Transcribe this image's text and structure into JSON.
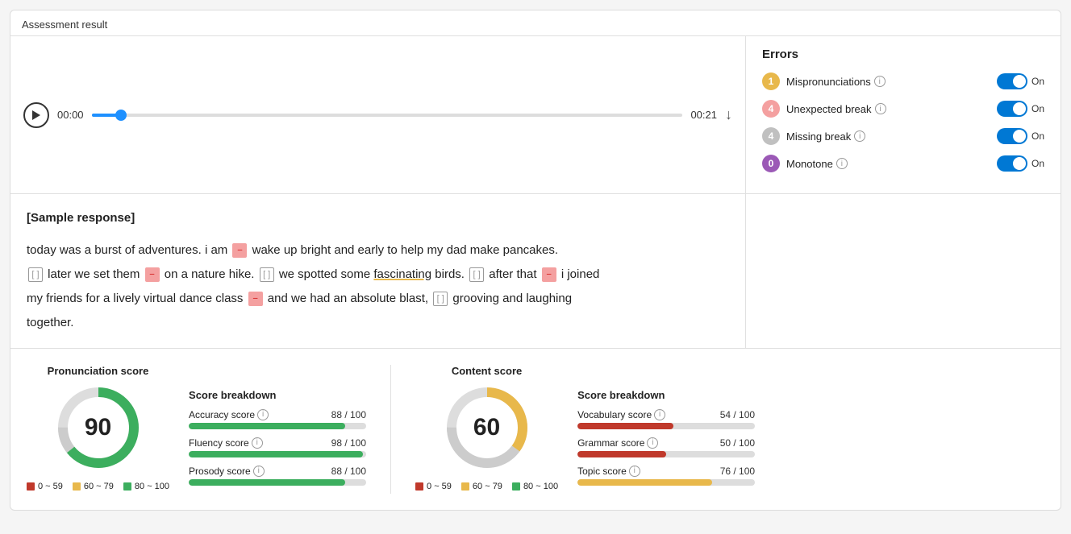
{
  "page": {
    "title": "Assessment result"
  },
  "audio": {
    "time_start": "00:00",
    "time_end": "00:21",
    "progress_pct": 5
  },
  "errors": {
    "title": "Errors",
    "items": [
      {
        "id": "mispronunciations",
        "count": "1",
        "label": "Mispronunciations",
        "badge_class": "badge-yellow",
        "toggle": "On"
      },
      {
        "id": "unexpected-break",
        "count": "4",
        "label": "Unexpected break",
        "badge_class": "badge-pink",
        "toggle": "On"
      },
      {
        "id": "missing-break",
        "count": "4",
        "label": "Missing break",
        "badge_class": "badge-gray",
        "toggle": "On"
      },
      {
        "id": "monotone",
        "count": "0",
        "label": "Monotone",
        "badge_class": "badge-purple",
        "toggle": "On"
      }
    ]
  },
  "text_response": {
    "sample_label": "[Sample response]",
    "sentences": [
      "today was a burst of adventures. i am [×] wake up bright and early to help my dad make pancakes.",
      "[ ] later we set them [×] on a nature hike. [ ] we spotted some fascinating birds. [ ] after that [×] i joined",
      "my friends for a lively virtual dance class [×] and we had an absolute blast, [ ] grooving and laughing",
      "together."
    ]
  },
  "pronunciation_score": {
    "title": "Pronunciation score",
    "value": 90,
    "donut_green_pct": 90,
    "legend": [
      {
        "color": "#c0392b",
        "label": "0 ~ 59"
      },
      {
        "color": "#e8b84b",
        "label": "60 ~ 79"
      },
      {
        "color": "#3cae5e",
        "label": "80 ~ 100"
      }
    ]
  },
  "pronunciation_breakdown": {
    "title": "Score breakdown",
    "items": [
      {
        "label": "Accuracy score",
        "value": "88 / 100",
        "pct": 88,
        "color": "green"
      },
      {
        "label": "Fluency score",
        "value": "98 / 100",
        "pct": 98,
        "color": "green"
      },
      {
        "label": "Prosody score",
        "value": "88 / 100",
        "pct": 88,
        "color": "green"
      }
    ]
  },
  "content_score": {
    "title": "Content score",
    "value": 60,
    "donut_yellow_pct": 60,
    "legend": [
      {
        "color": "#c0392b",
        "label": "0 ~ 59"
      },
      {
        "color": "#e8b84b",
        "label": "60 ~ 79"
      },
      {
        "color": "#3cae5e",
        "label": "80 ~ 100"
      }
    ]
  },
  "content_breakdown": {
    "title": "Score breakdown",
    "items": [
      {
        "label": "Vocabulary score",
        "value": "54 / 100",
        "pct": 54,
        "color": "red"
      },
      {
        "label": "Grammar score",
        "value": "50 / 100",
        "pct": 50,
        "color": "red"
      },
      {
        "label": "Topic score",
        "value": "76 / 100",
        "pct": 76,
        "color": "yellow"
      }
    ]
  }
}
